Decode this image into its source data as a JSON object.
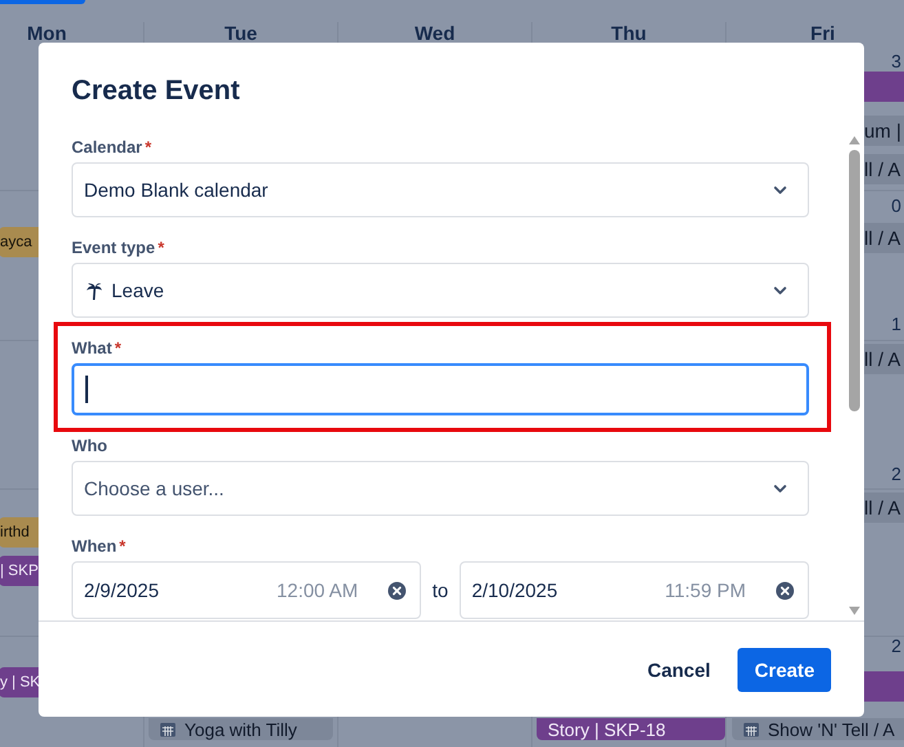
{
  "background": {
    "day_headers": [
      "Mon",
      "Tue",
      "Wed",
      "Thu",
      "Fri"
    ],
    "events": [
      {
        "color": "#6e3f8c",
        "kind": "plain"
      },
      {
        "text": "um |",
        "color": "#7d8799",
        "kind": "plain"
      },
      {
        "text": "ll / A",
        "color": "#7d8799",
        "kind": "plain"
      },
      {
        "text": "ayca",
        "color": "#a98b4f",
        "kind": "plain"
      },
      {
        "text": "ll / A",
        "color": "#7d8799",
        "kind": "plain"
      },
      {
        "text": "ll / A",
        "color": "#7d8799",
        "kind": "plain"
      },
      {
        "text": "ll / A",
        "color": "#7d8799",
        "kind": "plain"
      },
      {
        "text": "irthd",
        "color": "#a98b4f",
        "kind": "plain"
      },
      {
        "text": "| SKP",
        "color": "#6e3f8c",
        "kind": "plain"
      },
      {
        "text": "y | SK",
        "color": "#6e3f8c",
        "kind": "plain"
      },
      {
        "color": "#6e3f8c",
        "kind": "plain"
      },
      {
        "text": "Yoga with Tilly",
        "color": "#7d8799",
        "kind": "event"
      },
      {
        "text": "Story | SKP-18",
        "color": "#6e3f8c",
        "kind": "plain"
      },
      {
        "text": "Show 'N' Tell / A",
        "color": "#7d8799",
        "kind": "event"
      }
    ],
    "date_numbers": [
      "3",
      "0",
      "1",
      "2",
      "2"
    ]
  },
  "dialog": {
    "title": "Create Event",
    "fields": [
      {
        "kind": "select",
        "label": "Calendar",
        "required_mark": "*",
        "value": "Demo Blank calendar"
      },
      {
        "kind": "icon-select",
        "label": "Event type",
        "required_mark": "*",
        "value": "Leave"
      },
      {
        "kind": "text",
        "label": "What",
        "required_mark": "*",
        "focused": true,
        "highlighted": true
      },
      {
        "kind": "select",
        "label": "Who",
        "placeholder": "Choose a user..."
      },
      {
        "kind": "daterange",
        "label": "When",
        "required_mark": "*",
        "start_date": "2/9/2025",
        "start_time": "12:00 AM",
        "separator": "to",
        "end_date": "2/10/2025",
        "end_time": "11:59 PM"
      }
    ],
    "buttons": [
      {
        "label": "Cancel",
        "kind": "subtle"
      },
      {
        "label": "Create",
        "kind": "primary"
      }
    ]
  }
}
